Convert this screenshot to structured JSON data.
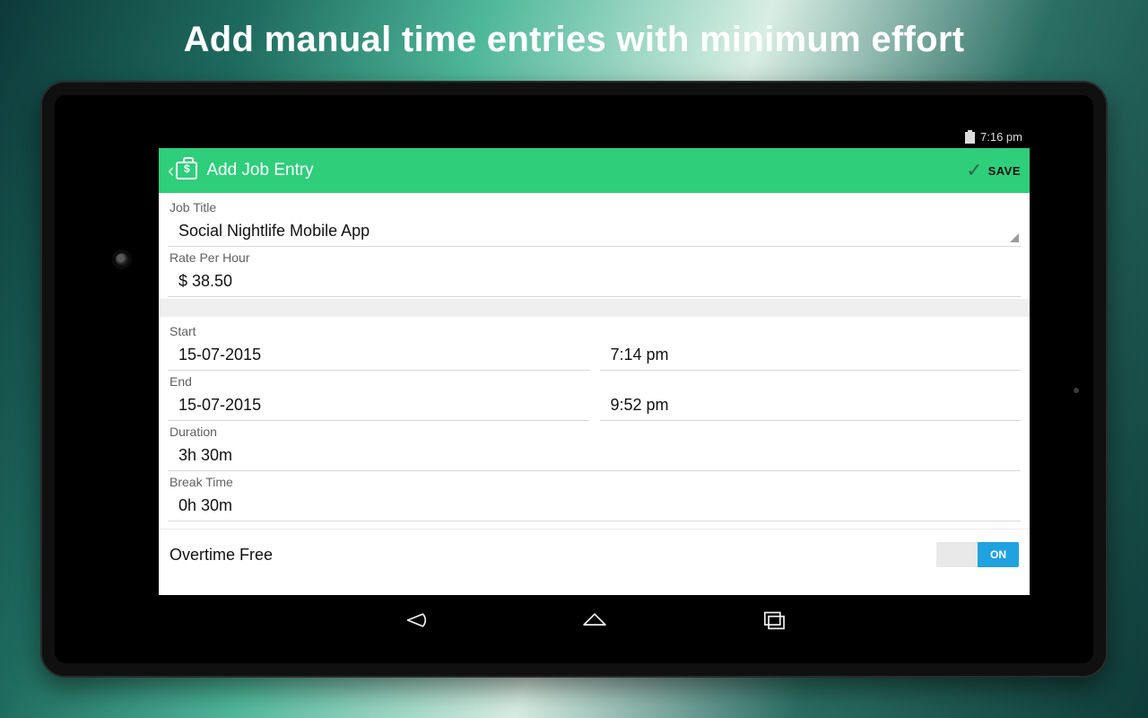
{
  "promo": {
    "title": "Add manual time entries with minimum effort"
  },
  "statusbar": {
    "time": "7:16 pm"
  },
  "actionbar": {
    "title": "Add Job Entry",
    "save_label": "SAVE"
  },
  "form": {
    "job_title_label": "Job Title",
    "job_title_value": "Social Nightlife Mobile App",
    "rate_label": "Rate Per Hour",
    "rate_value": "$ 38.50",
    "start_label": "Start",
    "start_date": "15-07-2015",
    "start_time": "7:14 pm",
    "end_label": "End",
    "end_date": "15-07-2015",
    "end_time": "9:52 pm",
    "duration_label": "Duration",
    "duration_value": "3h 30m",
    "break_label": "Break Time",
    "break_value": "0h 30m",
    "overtime_label": "Overtime Free",
    "toggle_on_label": "ON"
  }
}
